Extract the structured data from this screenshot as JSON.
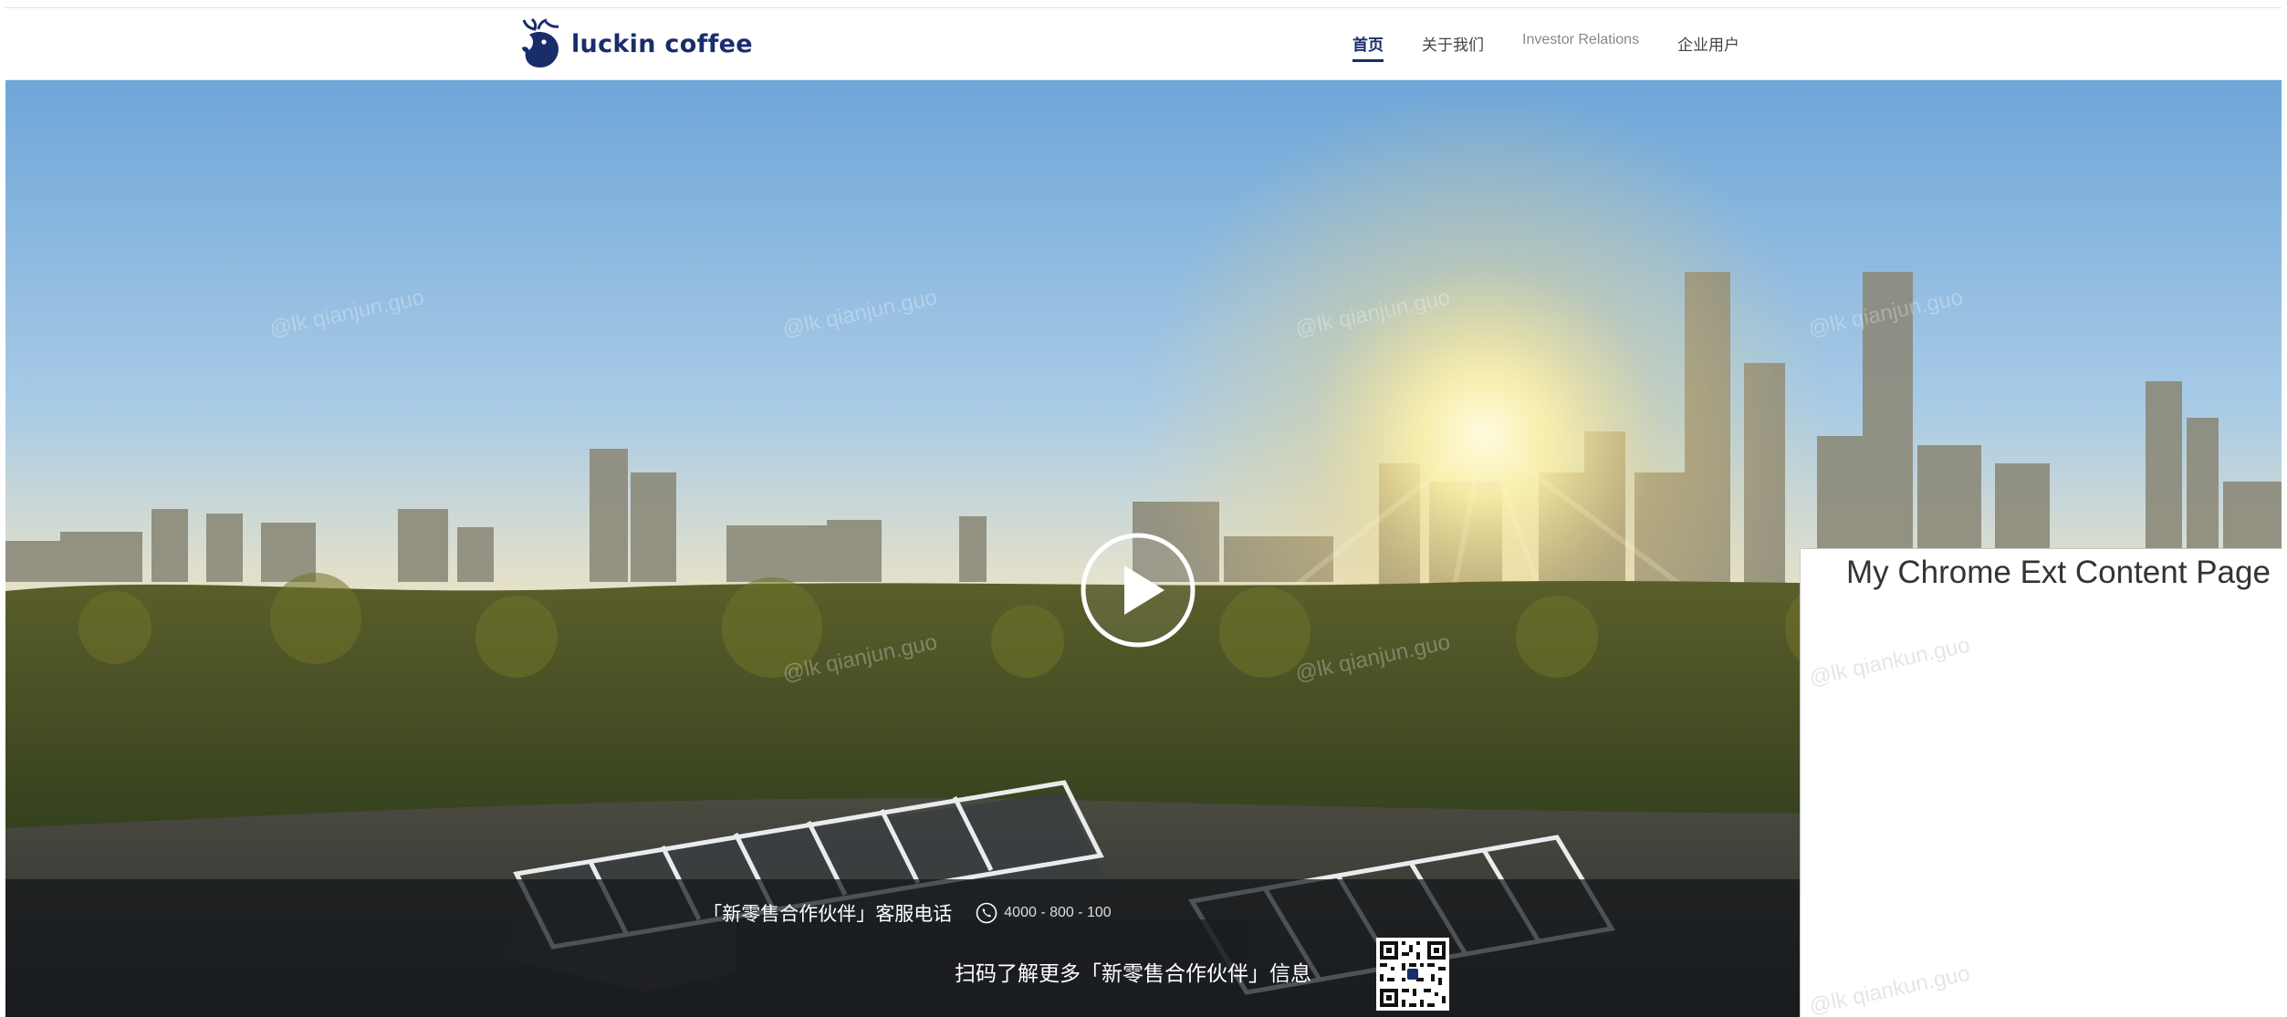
{
  "brand": {
    "name": "luckin coffee",
    "color": "#1a2d6b"
  },
  "nav": {
    "items": [
      {
        "label": "首页",
        "active": true
      },
      {
        "label": "关于我们",
        "active": false
      },
      {
        "label": "Investor Relations",
        "active": false
      },
      {
        "label": "企业用户",
        "active": false
      }
    ]
  },
  "hero": {
    "play_icon": "play-circle-icon",
    "watermark": "@lk qianjun.guo"
  },
  "info_bar": {
    "hotline_label": "「新零售合作伙伴」客服电话",
    "phone_icon": "phone-icon",
    "phone_number": "4000 - 800 - 100",
    "scan_text": "扫码了解更多「新零售合作伙伴」信息",
    "qr_icon": "qr-code-icon"
  },
  "extension": {
    "title": "My Chrome Ext Content Page",
    "watermark": "@lk qiankun.guo"
  }
}
